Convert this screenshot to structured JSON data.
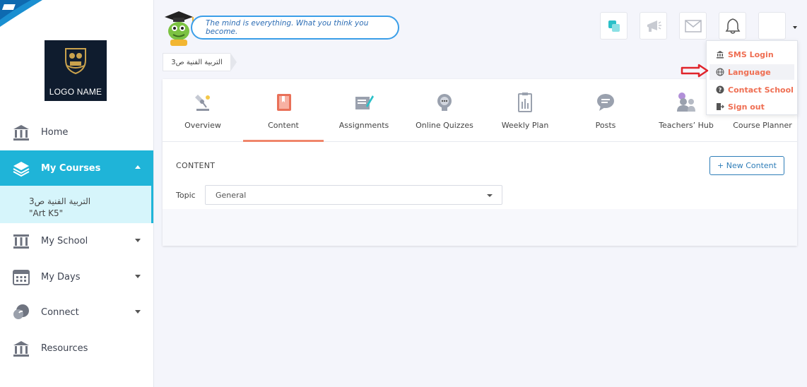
{
  "app": {
    "logo_text": "LOGO NAME",
    "quote": "The mind is everything. What you think you become."
  },
  "sidebar": {
    "items": [
      {
        "label": "Home",
        "icon": "building-icon"
      },
      {
        "label": "My Courses",
        "icon": "layers-icon"
      },
      {
        "label": "My School",
        "icon": "school-icon"
      },
      {
        "label": "My Days",
        "icon": "calendar-icon"
      },
      {
        "label": "Connect",
        "icon": "chat-icon"
      },
      {
        "label": "Resources",
        "icon": "library-icon"
      }
    ],
    "active_sub": {
      "line1": "التربية الفنية ص3",
      "line2": "\"Art K5\""
    }
  },
  "breadcrumb": {
    "label": "التربية الفنية ص3"
  },
  "tabs": [
    {
      "label": "Overview"
    },
    {
      "label": "Content"
    },
    {
      "label": "Assignments"
    },
    {
      "label": "Online Quizzes"
    },
    {
      "label": "Weekly Plan"
    },
    {
      "label": "Posts"
    },
    {
      "label": "Teachers’ Hub"
    },
    {
      "label": "Course Planner"
    }
  ],
  "content": {
    "title": "CONTENT",
    "new_button": "+ New Content",
    "topic_label": "Topic",
    "topic_value": "General"
  },
  "dropdown": {
    "items": [
      {
        "label": "SMS Login",
        "icon": "bank-icon"
      },
      {
        "label": "Language",
        "icon": "globe-icon"
      },
      {
        "label": "Contact School",
        "icon": "help-icon"
      },
      {
        "label": "Sign out",
        "icon": "signout-icon"
      }
    ]
  },
  "colors": {
    "accent": "#1fb4d8",
    "menu_text": "#ef6e52",
    "tab_underline": "#f0866b",
    "button": "#2e7db8"
  }
}
